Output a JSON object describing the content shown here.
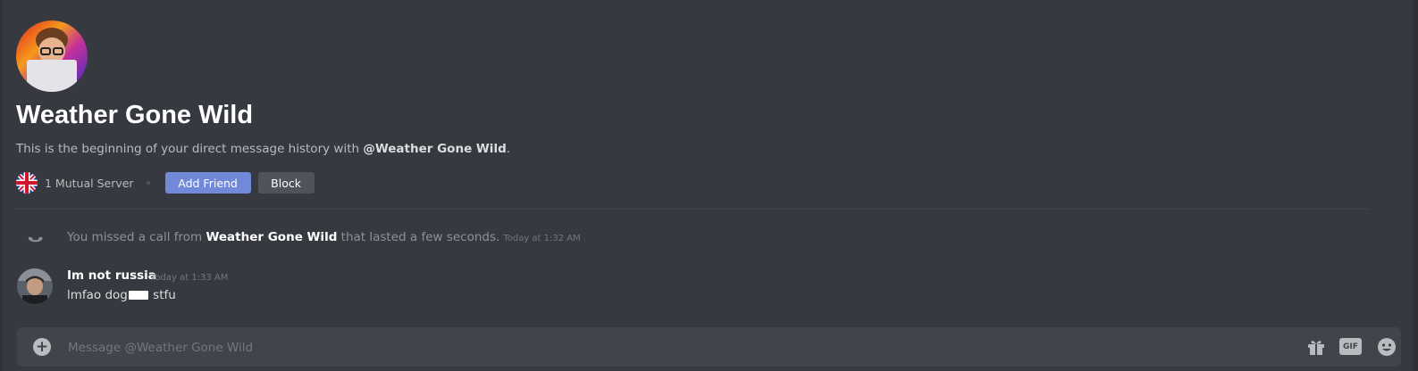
{
  "profile": {
    "name": "Weather Gone Wild",
    "intro_prefix": "This is the beginning of your direct message history with ",
    "intro_handle": "@Weather Gone Wild",
    "intro_suffix": ".",
    "mutual_servers": "1 Mutual Server",
    "add_friend_label": "Add Friend",
    "block_label": "Block"
  },
  "call": {
    "prefix": "You missed a call from ",
    "caller": "Weather Gone Wild",
    "suffix": " that lasted a few seconds.",
    "timestamp": "Today at 1:32 AM"
  },
  "message": {
    "author": "Im not russia",
    "timestamp": "Today at 1:33 AM",
    "text_before": "lmfao dog",
    "text_after": " stfu"
  },
  "composer": {
    "placeholder": "Message @Weather Gone Wild",
    "gif_label": "GIF"
  },
  "colors": {
    "background": "#36393f",
    "accent": "#7289da",
    "composer": "#40444b"
  }
}
